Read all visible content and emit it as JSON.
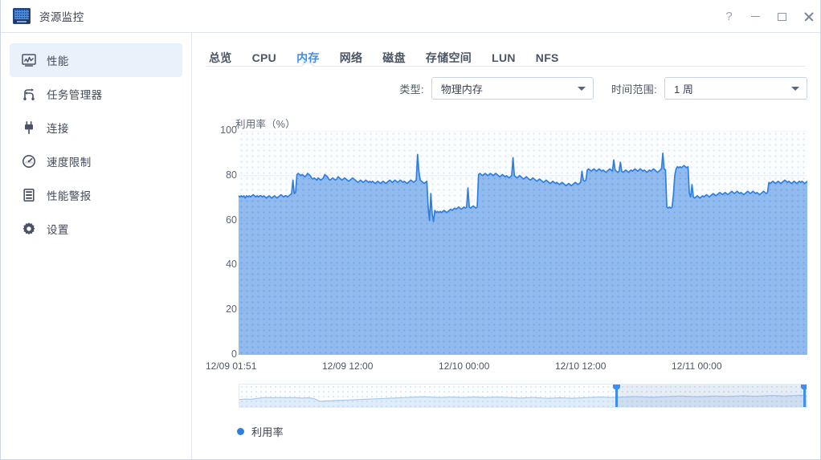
{
  "window": {
    "title": "资源监控",
    "app_icon": "monitor-icon",
    "controls": [
      {
        "name": "help-button",
        "glyph": "?"
      },
      {
        "name": "minimize-button",
        "glyph": "—"
      },
      {
        "name": "maximize-button",
        "glyph": "▢"
      },
      {
        "name": "close-button",
        "glyph": "✕"
      }
    ]
  },
  "sidebar": {
    "items": [
      {
        "label": "性能",
        "icon": "performance-chart-icon",
        "active": true
      },
      {
        "label": "任务管理器",
        "icon": "task-manager-icon",
        "active": false
      },
      {
        "label": "连接",
        "icon": "plug-connection-icon",
        "active": false
      },
      {
        "label": "速度限制",
        "icon": "speed-gauge-icon",
        "active": false
      },
      {
        "label": "性能警报",
        "icon": "alert-server-icon",
        "active": false
      },
      {
        "label": "设置",
        "icon": "gear-icon",
        "active": false
      }
    ]
  },
  "tabs": [
    {
      "label": "总览",
      "active": false
    },
    {
      "label": "CPU",
      "active": false
    },
    {
      "label": "内存",
      "active": true
    },
    {
      "label": "网络",
      "active": false
    },
    {
      "label": "磁盘",
      "active": false
    },
    {
      "label": "存储空间",
      "active": false
    },
    {
      "label": "LUN",
      "active": false
    },
    {
      "label": "NFS",
      "active": false
    }
  ],
  "controls": {
    "type_label": "类型:",
    "type_value": "物理内存",
    "range_label": "时间范围:",
    "range_value": "1 周"
  },
  "legend": {
    "series_label": "利用率",
    "color": "#2f7fe0"
  },
  "colors": {
    "accent": "#3e8ef0",
    "line": "#2f7fe0",
    "fill": "#8ebdf5",
    "sidebar_active_bg": "#e9f1fa",
    "text": "#3a4250"
  },
  "chart_data": {
    "type": "area",
    "title": "",
    "ylabel": "利用率（%）",
    "xlabel": "",
    "ylim": [
      0,
      100
    ],
    "yticks": [
      0,
      20,
      40,
      60,
      80,
      100
    ],
    "xticks": [
      "12/09 01:51",
      "12/09 12:00",
      "12/10 00:00",
      "12/10 12:00",
      "12/11 00:00"
    ],
    "grid": true,
    "legend_position": "bottom-left",
    "series": [
      {
        "name": "利用率",
        "color": "#2f7fe0",
        "values": [
          71,
          70.5,
          71,
          70.5,
          71,
          70,
          71,
          70.5,
          71,
          70.5,
          71,
          71.5,
          71,
          70.5,
          71,
          70.5,
          71,
          71,
          70.5,
          71,
          70.5,
          70,
          70.5,
          71,
          70.5,
          70,
          70.5,
          71,
          70.5,
          70,
          70.5,
          71,
          71.5,
          71,
          70.5,
          71,
          71,
          70.5,
          71,
          71.5,
          72,
          78,
          72,
          72.5,
          80.5,
          81,
          80.5,
          80,
          80.5,
          80,
          79.5,
          80,
          81,
          80.5,
          80,
          79,
          78.5,
          79,
          78.5,
          78,
          79,
          78.5,
          78,
          78.5,
          79,
          80.5,
          80,
          79.5,
          78.5,
          78,
          78.5,
          79,
          78.5,
          78,
          78.5,
          79.5,
          79,
          78.5,
          78,
          78.5,
          79,
          78.5,
          78,
          77.5,
          78,
          78.5,
          79,
          78.5,
          78,
          77.5,
          77,
          77.5,
          78,
          77.5,
          77,
          77.5,
          78,
          77.5,
          77,
          77.5,
          77,
          77.5,
          77,
          76.5,
          77,
          77.5,
          77,
          76.5,
          77,
          77.5,
          77,
          76.5,
          77,
          77.5,
          78,
          77.5,
          77,
          77.5,
          78,
          77.5,
          77,
          77.5,
          78,
          77.5,
          77,
          77.5,
          77,
          76.5,
          77,
          77.5,
          78,
          77.5,
          77,
          77.5,
          78,
          89.5,
          82,
          78,
          77.5,
          77,
          76.5,
          77,
          77.5,
          66,
          60,
          72,
          63,
          59.5,
          64.5,
          63.5,
          64,
          63.5,
          64,
          63.5,
          64,
          64.5,
          64,
          63.5,
          64,
          64.5,
          65,
          64.5,
          65,
          65.5,
          65,
          65.5,
          66,
          65.5,
          65,
          65.5,
          66,
          65.5,
          66,
          74.5,
          66,
          65.5,
          66,
          66.5,
          66,
          65.5,
          66,
          80.5,
          81,
          80.5,
          80,
          80.5,
          81,
          80.5,
          80,
          80.5,
          81,
          80.5,
          80,
          80.5,
          81,
          80.5,
          80,
          79.5,
          80,
          80.5,
          80,
          79.5,
          80,
          79.5,
          79,
          79.5,
          80,
          88,
          80,
          79.5,
          79,
          79.5,
          80,
          79.5,
          79,
          78.5,
          79,
          79.5,
          79,
          78.5,
          78,
          78.5,
          79,
          78.5,
          78,
          77.5,
          78,
          78.5,
          78,
          77.5,
          77,
          77.5,
          78,
          77.5,
          77,
          76.5,
          77,
          77.5,
          77,
          76.5,
          77,
          76.5,
          76,
          76.5,
          77,
          76.5,
          76,
          75.5,
          76,
          76.5,
          76,
          75.5,
          76,
          76.5,
          77,
          76.5,
          76,
          76.5,
          77,
          82,
          78,
          77.5,
          78,
          82.5,
          83,
          82.5,
          82,
          82.5,
          83,
          82.5,
          82,
          82.5,
          83,
          82.5,
          82,
          82.5,
          82,
          81.5,
          82,
          82.5,
          83,
          82.5,
          82,
          87,
          82.5,
          82,
          81.5,
          82,
          86,
          82,
          81.5,
          82,
          82.5,
          82,
          81.5,
          82,
          82.5,
          82,
          82.5,
          83,
          82.5,
          82,
          82.5,
          83,
          82.5,
          82,
          82.5,
          82,
          81.5,
          82,
          82.5,
          82,
          82.5,
          83,
          82.5,
          82,
          81.5,
          82,
          82.5,
          83,
          90,
          83,
          82.5,
          66,
          65.5,
          66,
          65.5,
          66,
          71.5,
          80,
          83,
          84,
          83.5,
          84,
          83.5,
          84,
          84.5,
          84,
          83.5,
          84,
          72,
          70.5,
          76,
          70.5,
          70,
          70.5,
          71,
          70.5,
          70,
          70.5,
          71,
          70.5,
          71,
          71.5,
          71,
          70.5,
          71,
          71.5,
          72,
          71.5,
          71,
          71.5,
          72,
          72.5,
          72,
          71.5,
          72,
          72.5,
          72,
          71.5,
          72,
          72.5,
          73,
          72.5,
          72,
          72.5,
          73,
          72.5,
          72,
          72.5,
          72,
          71.5,
          72,
          72.5,
          73,
          72.5,
          72,
          72.5,
          73,
          72.5,
          72,
          72.5,
          72,
          71.5,
          72,
          72.5,
          73,
          72.5,
          72,
          72.5,
          77,
          76.5,
          77,
          77.5,
          77,
          76.5,
          77,
          77.5,
          77,
          76.5,
          77,
          77.5,
          78,
          77.5,
          77,
          77.5,
          77,
          76.5,
          77,
          77.5,
          77,
          76.5,
          77,
          77.5,
          77,
          77.5,
          77,
          76.5,
          77,
          77.5
        ]
      }
    ],
    "overview_values": [
      70,
      71,
      70.5,
      72,
      73.5,
      74,
      73.5,
      74,
      73.5,
      74,
      73.5,
      73,
      73.5,
      72,
      66.5,
      67,
      67.5,
      68,
      68.5,
      69,
      69.5,
      70,
      70.5,
      71,
      71.5,
      72,
      72.5,
      73,
      73.5,
      74,
      74.5,
      75,
      75.5,
      75,
      74.5,
      74,
      74.5,
      75,
      74.5,
      74,
      74.5,
      75,
      74.5,
      74,
      74.5,
      75,
      74.5,
      74,
      73.5,
      73,
      73.5,
      74,
      73.5,
      73,
      72.5,
      73,
      73.5,
      73,
      72.5,
      73,
      73.5,
      74,
      74.5,
      75,
      74.5,
      74,
      74.5,
      75,
      75.5,
      76,
      75.5,
      75,
      74.5,
      75,
      75.5,
      76,
      76.5,
      77,
      76.5,
      76,
      75.5,
      76,
      76.5,
      77,
      76.5,
      76,
      76.5,
      77,
      77.5,
      77,
      76.5,
      77,
      77.5,
      78,
      77.5,
      77,
      77.5,
      78,
      78.5,
      78
    ],
    "selection": {
      "start_pct": 66.5,
      "end_pct": 100
    }
  }
}
